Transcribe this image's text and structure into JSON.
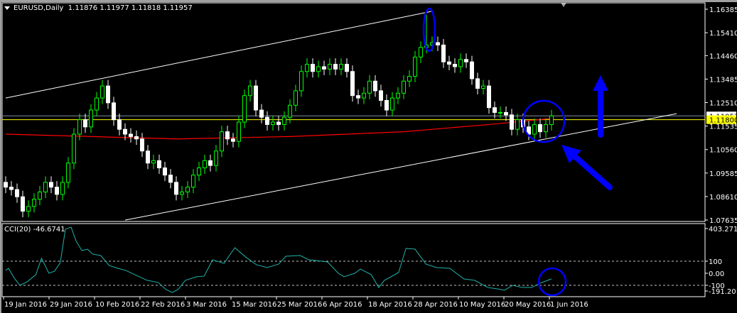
{
  "header": {
    "symbol_timeframe": "EURUSD,Daily",
    "ohlc": "1.11876 1.11977 1.11818 1.11957"
  },
  "cci_title": "CCI(20) -46.6741",
  "colors": {
    "background": "#000000",
    "bear_body": "#ffffff",
    "bull_wick": "#00ff00",
    "ma": "#ff0000",
    "level_line": "#ffff00",
    "cci": "#20b2aa",
    "annotation": "#0000ff",
    "channel": "#ffffff"
  },
  "chart_data": {
    "type": "candlestick",
    "symbol": "EURUSD",
    "timeframe": "Daily",
    "price_ticks": [
      "1.16385",
      "1.15410",
      "1.14460",
      "1.13485",
      "1.12510",
      "1.11535",
      "1.10560",
      "1.09585",
      "1.08610",
      "1.07635"
    ],
    "price_range": [
      1.07635,
      1.16385
    ],
    "current_price": "1.11957",
    "level_line": "1.11800",
    "date_labels": [
      "19 Jan 2016",
      "29 Jan 2016",
      "10 Feb 2016",
      "22 Feb 2016",
      "3 Mar 2016",
      "15 Mar 2016",
      "25 Mar 2016",
      "6 Apr 2016",
      "18 Apr 2016",
      "28 Apr 2016",
      "10 May 2016",
      "20 May 2016",
      "1 Jun 2016"
    ],
    "date_label_every_bars": 8,
    "close": [
      1.09,
      1.089,
      1.086,
      1.08,
      1.082,
      1.085,
      1.088,
      1.092,
      1.09,
      1.087,
      1.092,
      1.1,
      1.112,
      1.118,
      1.115,
      1.122,
      1.127,
      1.132,
      1.125,
      1.118,
      1.114,
      1.112,
      1.111,
      1.11,
      1.105,
      1.1,
      1.101,
      1.098,
      1.095,
      1.092,
      1.087,
      1.088,
      1.09,
      1.095,
      1.098,
      1.101,
      1.099,
      1.105,
      1.113,
      1.11,
      1.109,
      1.117,
      1.128,
      1.132,
      1.122,
      1.119,
      1.116,
      1.117,
      1.116,
      1.119,
      1.124,
      1.13,
      1.138,
      1.141,
      1.138,
      1.14,
      1.139,
      1.141,
      1.139,
      1.141,
      1.138,
      1.128,
      1.127,
      1.129,
      1.134,
      1.13,
      1.126,
      1.122,
      1.127,
      1.129,
      1.134,
      1.136,
      1.144,
      1.148,
      1.149,
      1.15,
      1.149,
      1.142,
      1.141,
      1.14,
      1.143,
      1.142,
      1.135,
      1.131,
      1.132,
      1.123,
      1.121,
      1.121,
      1.12,
      1.114,
      1.118,
      1.115,
      1.112,
      1.116,
      1.113,
      1.116,
      1.1196
    ],
    "spike_high": {
      "bar": 74,
      "price": 1.1616
    },
    "moving_average": [
      [
        0,
        1.112
      ],
      [
        30,
        1.11
      ],
      [
        50,
        1.111
      ],
      [
        70,
        1.113
      ],
      [
        85,
        1.116
      ],
      [
        96,
        1.1185
      ]
    ],
    "channel_upper": [
      [
        0,
        1.127
      ],
      [
        75,
        1.163
      ]
    ],
    "channel_lower": [
      [
        21,
        1.0763
      ],
      [
        118,
        1.1205
      ]
    ],
    "cci": {
      "period": 20,
      "value": "-46.6741",
      "ticks": [
        "403.271",
        "100",
        "0.00",
        "-100",
        "-191.2012"
      ],
      "levels": [
        100,
        -100
      ],
      "points": [
        [
          0,
          24
        ],
        [
          0.5,
          41
        ],
        [
          1.5,
          -40
        ],
        [
          2.5,
          -100
        ],
        [
          3.8,
          -70
        ],
        [
          5.3,
          -12
        ],
        [
          6.3,
          124
        ],
        [
          7.6,
          0
        ],
        [
          8.6,
          18
        ],
        [
          9.6,
          88
        ],
        [
          10.5,
          365
        ],
        [
          11.5,
          382
        ],
        [
          12.4,
          265
        ],
        [
          13.4,
          188
        ],
        [
          14.4,
          200
        ],
        [
          15.3,
          159
        ],
        [
          16.7,
          147
        ],
        [
          18.2,
          65
        ],
        [
          19.7,
          41
        ],
        [
          21.1,
          24
        ],
        [
          23,
          -18
        ],
        [
          24.9,
          -59
        ],
        [
          26.8,
          -76
        ],
        [
          28.2,
          -135
        ],
        [
          29.3,
          -159
        ],
        [
          30.3,
          -135
        ],
        [
          31.6,
          -59
        ],
        [
          33.6,
          -29
        ],
        [
          34.9,
          -24
        ],
        [
          36.4,
          112
        ],
        [
          38.4,
          82
        ],
        [
          40.3,
          212
        ],
        [
          42.2,
          135
        ],
        [
          44.1,
          71
        ],
        [
          46,
          47
        ],
        [
          48,
          76
        ],
        [
          49.3,
          141
        ],
        [
          51.8,
          147
        ],
        [
          53.3,
          112
        ],
        [
          56.6,
          94
        ],
        [
          58.5,
          0
        ],
        [
          59.5,
          -29
        ],
        [
          61.4,
          0
        ],
        [
          62.4,
          35
        ],
        [
          64.3,
          -12
        ],
        [
          65.6,
          -118
        ],
        [
          66.6,
          -59
        ],
        [
          69.1,
          6
        ],
        [
          70.4,
          206
        ],
        [
          72,
          200
        ],
        [
          73.9,
          76
        ],
        [
          75.8,
          47
        ],
        [
          78.1,
          41
        ],
        [
          80.6,
          -47
        ],
        [
          82.5,
          -59
        ],
        [
          84.8,
          -118
        ],
        [
          86.4,
          -129
        ],
        [
          87.7,
          -141
        ],
        [
          89.2,
          -100
        ],
        [
          90.8,
          -118
        ],
        [
          92.5,
          -118
        ],
        [
          94,
          -82
        ],
        [
          96,
          -47
        ]
      ]
    }
  }
}
